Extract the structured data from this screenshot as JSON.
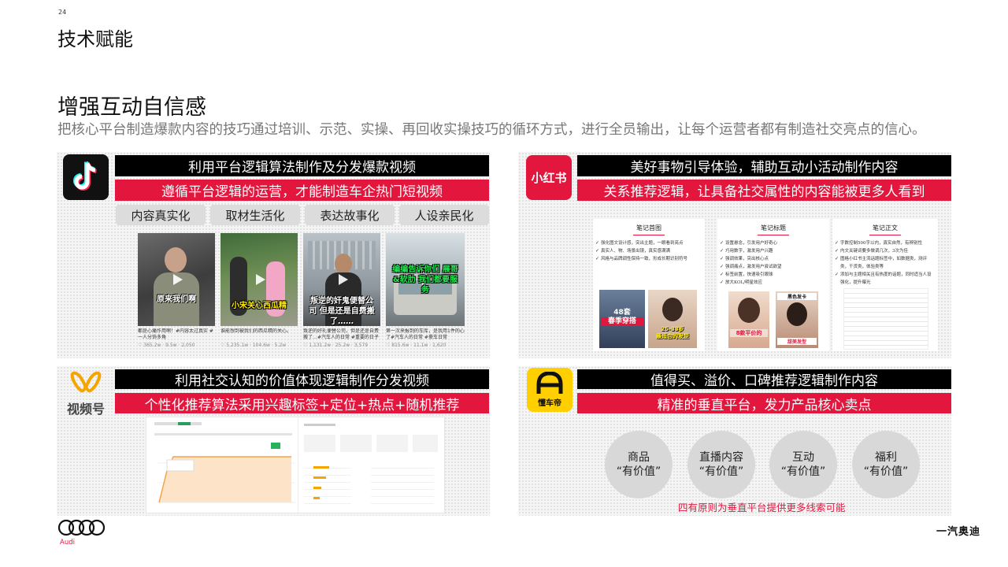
{
  "page_number": "24",
  "title": "技术赋能",
  "heading": "增强互动自信感",
  "subtitle": "把核心平台制造爆款内容的技巧通过培训、示范、实操、再回收实操技巧的循环方式，进行全员输出，让每个运营者都有制造社交亮点的信心。",
  "colors": {
    "accent": "#e3163d",
    "bar_black": "#000000",
    "tag_gray": "#dcdcdc",
    "circle_gray": "#d8d8d8"
  },
  "douyin": {
    "icon": "douyin-logo-icon",
    "black_bar": "利用平台逻辑算法制作及分发爆款视频",
    "red_bar": "遵循平台逻辑的运营，才能制造车企热门短视频",
    "tags": [
      "内容真实化",
      "取材生活化",
      "表达故事化",
      "人设亲民化"
    ],
    "videos": [
      {
        "overlay": "原来我们啊",
        "caption": "都是心痛作用啊！#内容太过真实 #一人分饰多角",
        "likes": "365.2w",
        "comments": "9.5w",
        "shares": "2,050"
      },
      {
        "overlay": "小宋关心西瓜精",
        "caption": "谁能想到被我们的西瓜精的关心。",
        "likes": "5,235.1w",
        "comments": "104.6w",
        "shares": "5.2w"
      },
      {
        "overlay": "叛逆的奸鬼便替公司 但是还是自费搬了……",
        "caption": "叛逆的好礼便替公司，但是还是自费搬了…#汽车人的日常 #重要的日子",
        "likes": "1,131.2w",
        "comments": "25.2w",
        "shares": "3,579"
      },
      {
        "overlay": "编编告诉你们 展哥&软肋 我们都要服务",
        "caption": "第一次来报到的车库，是我用1件的心了#汽车人的日常 #豪车日常",
        "likes": "815.6w",
        "comments": "11.1w",
        "shares": "1,620"
      }
    ]
  },
  "xiaohongshu": {
    "logo_text": "小红书",
    "black_bar": "美好事物引导体验，辅助互动小活动制作内容",
    "red_bar": "关系推荐逻辑，让具备社交属性的内容能被更多人看到",
    "notes": [
      {
        "title": "笔记首图",
        "items": [
          "强化图文设计感，突出主题，一眼看到亮点",
          "真实人、物、场景出镜，真实感满满",
          "风格与品牌调性保持一致，形成长期识别符号"
        ],
        "img_text": [
          "48套",
          "春季穿搭",
          "25-33岁",
          "最适合的发型"
        ]
      },
      {
        "title": "笔记标题",
        "items": [
          "设置悬念，引发用户好奇心",
          "巧用数字，激发用户兴趣",
          "强调效果，突出核心点",
          "强调痛点，激发用户尝试欲望",
          "标签前置，快速吸引眼球",
          "放大KOL/明星效应"
        ],
        "img_text": [
          "8款平价的",
          "黑色",
          "发卡",
          "甜美发型"
        ]
      },
      {
        "title": "笔记正文",
        "items": [
          "字数控制500字以内，真实自然，有辨别性",
          "内文关键词要多做调几次，3次为佳",
          "图格小红书主流话题标签中，如数据类，测评类，干货类，体验类等",
          "添加与主题相关且有热度的话题，同时适当人设强化，提升曝光"
        ],
        "img_text": []
      }
    ]
  },
  "shipinhao": {
    "logo_text": "视频号",
    "black_bar": "利用社交认知的价值体现逻辑制作分发视频",
    "red_bar": "个性化推荐算法采用兴趣标签+定位+热点+随机推荐"
  },
  "dongchedi": {
    "logo_text": "懂车帝",
    "black_bar": "值得买、溢价、口碑推荐逻辑制作内容",
    "red_bar": "精准的垂直平台，发力产品核心卖点",
    "circles": [
      {
        "line1": "商品",
        "line2": "“有价值”"
      },
      {
        "line1": "直播内容",
        "line2": "“有价值”"
      },
      {
        "line1": "互动",
        "line2": "“有价值”"
      },
      {
        "line1": "福利",
        "line2": "“有价值”"
      }
    ],
    "footnote": "四有原则为垂直平台提供更多线索可能"
  },
  "footer": {
    "logo_icon": "audi-rings-icon",
    "audi_text": "Audi",
    "brand": "一汽奥迪"
  }
}
